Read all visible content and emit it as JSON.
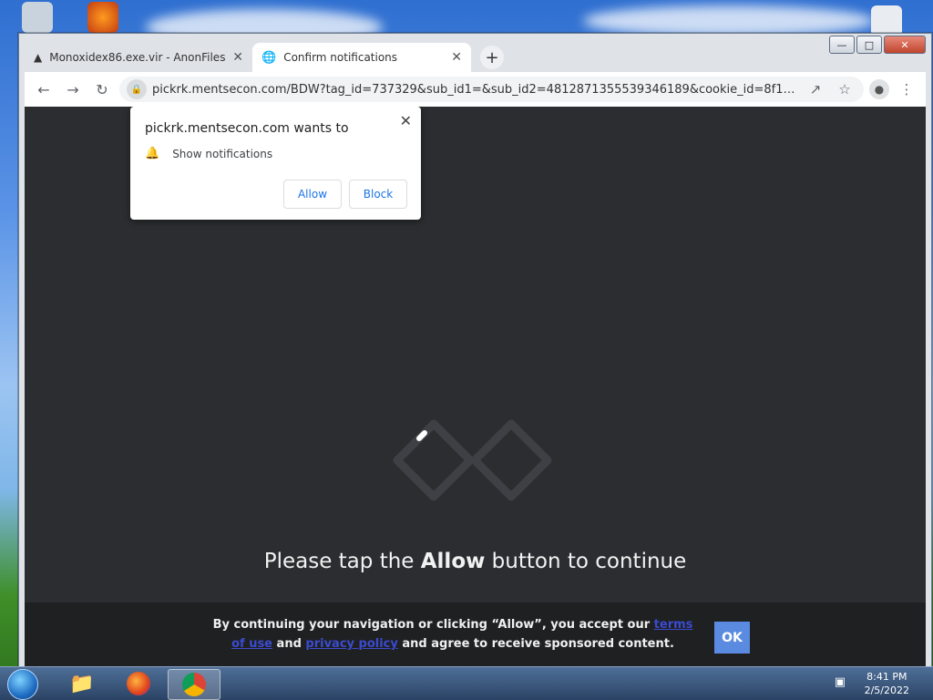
{
  "browser": {
    "tabs": [
      {
        "title": "Monoxidex86.exe.vir - AnonFiles",
        "icon": "anonfiles-icon",
        "active": false
      },
      {
        "title": "Confirm notifications",
        "icon": "globe-icon",
        "active": true
      }
    ],
    "url": "pickrk.mentsecon.com/BDW?tag_id=737329&sub_id1=&sub_id2=4812871355539346189&cookie_id=8f1bf71e-f..."
  },
  "permission_popup": {
    "title": "pickrk.mentsecon.com wants to",
    "permission": "Show notifications",
    "allow_label": "Allow",
    "block_label": "Block"
  },
  "page": {
    "cta_prefix": "Please tap the ",
    "cta_bold": "Allow",
    "cta_suffix": " button to continue",
    "consent_part1": "By continuing your navigation or clicking “Allow”, you accept our ",
    "consent_link1": "terms of use",
    "consent_part2": " and ",
    "consent_link2": "privacy policy",
    "consent_part3": " and agree to receive sponsored content.",
    "ok_label": "OK"
  },
  "taskbar": {
    "time": "8:41 PM",
    "date": "2/5/2022"
  },
  "colors": {
    "page_bg": "#2b2d30",
    "ok_button": "#5b8be0",
    "link": "#3b4bd0"
  }
}
